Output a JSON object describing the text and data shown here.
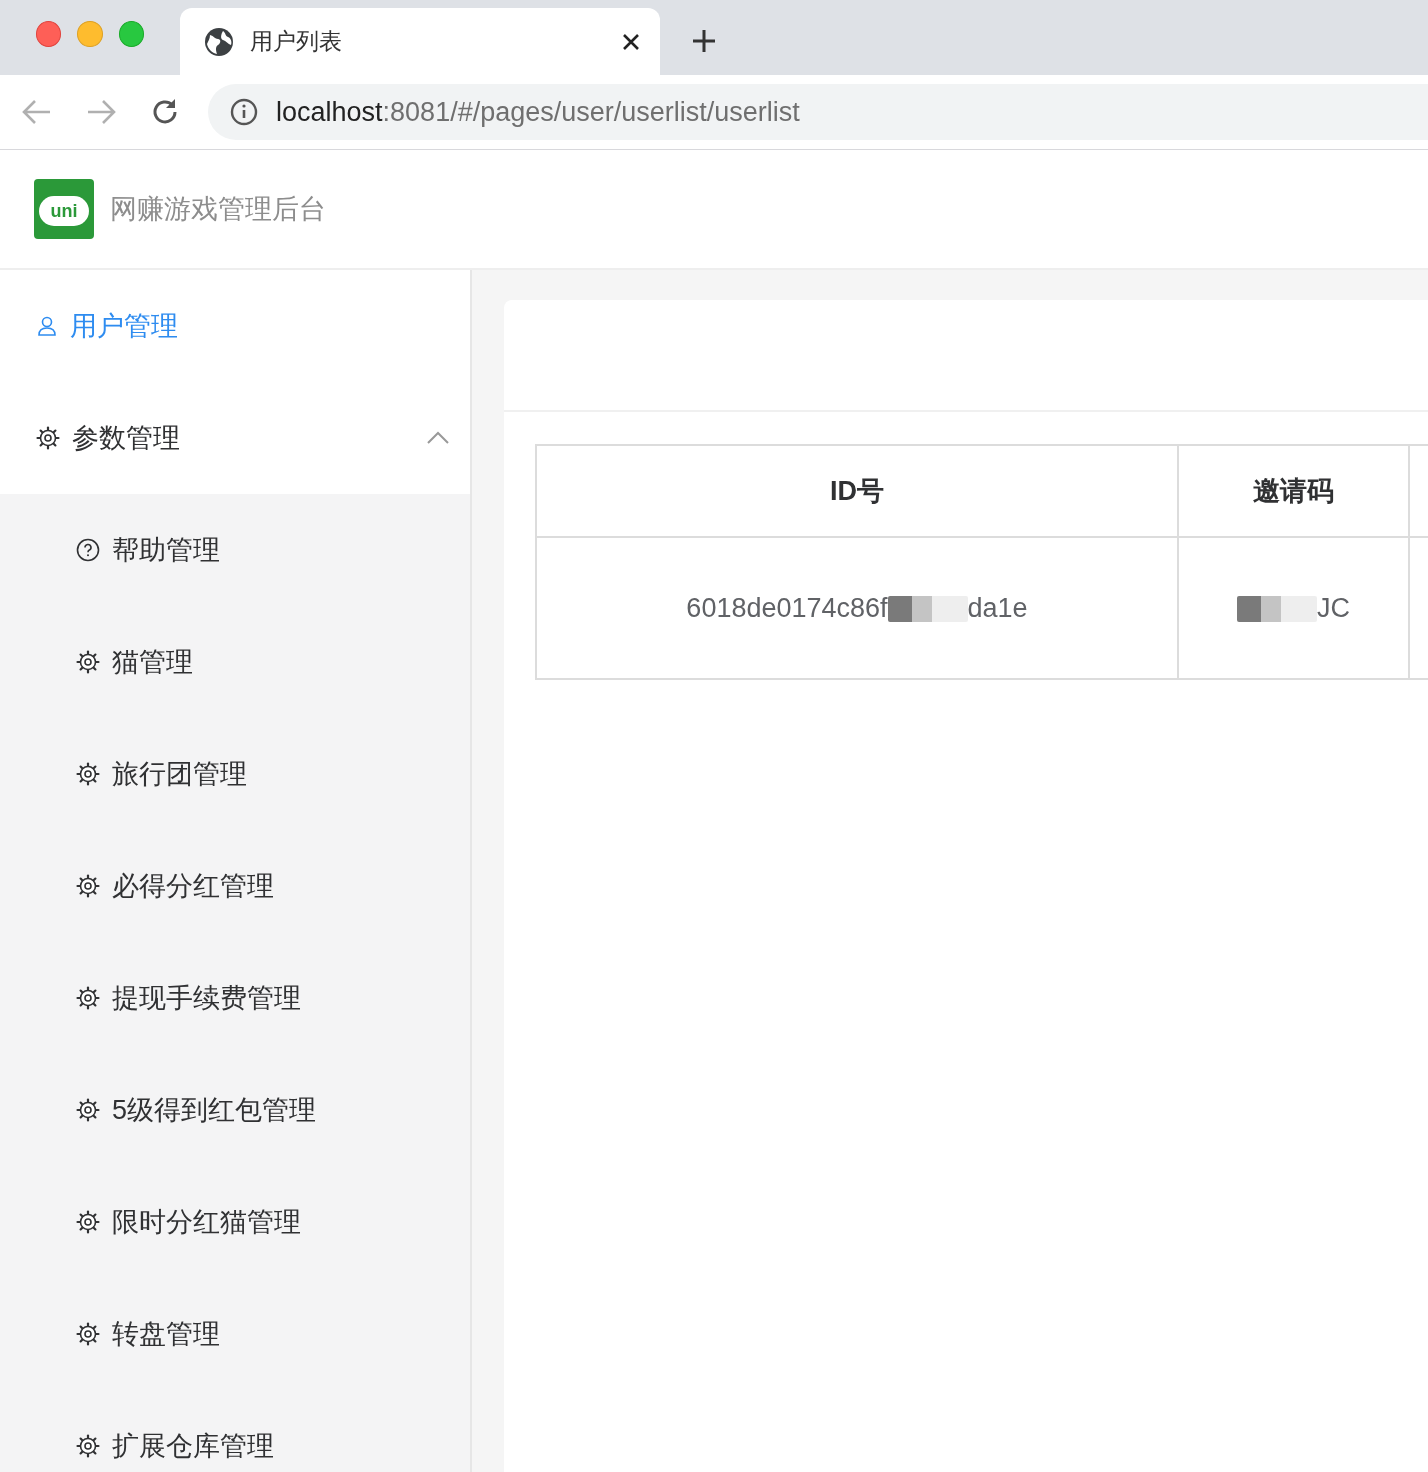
{
  "browser": {
    "tab_title": "用户列表",
    "url_host": "localhost",
    "url_rest": ":8081/#/pages/user/userlist/userlist"
  },
  "app": {
    "logo_text": "uni",
    "title": "网赚游戏管理后台"
  },
  "menu": [
    {
      "label": "用户管理",
      "kind": "user",
      "selected": true
    },
    {
      "label": "参数管理",
      "kind": "gear",
      "selected": false,
      "expanded": true,
      "children": [
        {
          "label": "帮助管理",
          "kind": "help",
          "selected": false
        },
        {
          "label": "猫管理",
          "kind": "gear",
          "selected": false
        },
        {
          "label": "旅行团管理",
          "kind": "gear",
          "selected": false
        },
        {
          "label": "必得分红管理",
          "kind": "gear",
          "selected": false
        },
        {
          "label": "提现手续费管理",
          "kind": "gear",
          "selected": false
        },
        {
          "label": "5级得到红包管理",
          "kind": "gear",
          "selected": false
        },
        {
          "label": "限时分红猫管理",
          "kind": "gear",
          "selected": false
        },
        {
          "label": "转盘管理",
          "kind": "gear",
          "selected": false
        },
        {
          "label": "扩展仓库管理",
          "kind": "gear",
          "selected": false
        }
      ]
    }
  ],
  "table": {
    "columns": [
      "ID号",
      "邀请码"
    ],
    "rows": [
      [
        {
          "before": "6018de0174c86f",
          "after": "da1e",
          "redacted": true
        },
        {
          "after": "JC",
          "redacted": true
        }
      ]
    ]
  }
}
